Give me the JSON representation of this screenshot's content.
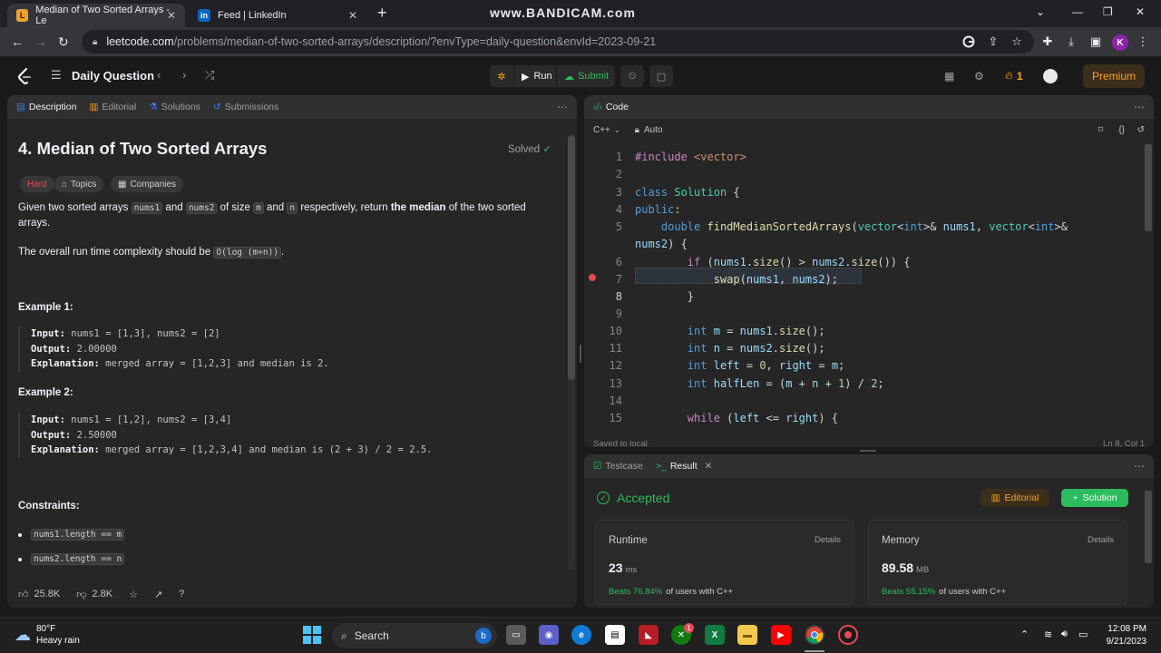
{
  "browser": {
    "tabs": [
      {
        "title": "Median of Two Sorted Arrays - Le"
      },
      {
        "title": "Feed | LinkedIn"
      }
    ],
    "watermark": "www.BANDICAM.com",
    "url_host": "leetcode.com",
    "url_path": "/problems/median-of-two-sorted-arrays/description/?envType=daily-question&envId=2023-09-21",
    "profile_initial": "K"
  },
  "nav": {
    "daily_label": "Daily Question",
    "run_label": "Run",
    "submit_label": "Submit",
    "streak": "1",
    "premium_label": "Premium"
  },
  "desc_tabs": [
    "Description",
    "Editorial",
    "Solutions",
    "Submissions"
  ],
  "problem": {
    "title": "4. Median of Two Sorted Arrays",
    "solved": "Solved",
    "difficulty": "Hard",
    "tag_topics": "Topics",
    "tag_companies": "Companies",
    "p1a": "Given two sorted arrays ",
    "c_nums1": "nums1",
    "p1b": " and ",
    "c_nums2": "nums2",
    "p1c": " of size ",
    "c_m": "m",
    "p1d": " and ",
    "c_n": "n",
    "p1e": " respectively, return ",
    "p1bold": "the median",
    "p1f": " of the two sorted",
    "p1g": "arrays.",
    "p2a": "The overall run time complexity should be ",
    "c_complexity": "O(log (m+n))",
    "p2b": ".",
    "ex1_title": "Example 1:",
    "ex1_input_label": "Input:",
    "ex1_input": " nums1 = [1,3], nums2 = [2]",
    "ex1_output_label": "Output:",
    "ex1_output": " 2.00000",
    "ex1_expl_label": "Explanation:",
    "ex1_expl": " merged array = [1,2,3] and median is 2.",
    "ex2_title": "Example 2:",
    "ex2_input_label": "Input:",
    "ex2_input": " nums1 = [1,2], nums2 = [3,4]",
    "ex2_output_label": "Output:",
    "ex2_output": " 2.50000",
    "ex2_expl_label": "Explanation:",
    "ex2_expl": " merged array = [1,2,3,4] and median is (2 + 3) / 2 = 2.5.",
    "constraints_title": "Constraints:",
    "constraint1": "nums1.length == m",
    "constraint2": "nums2.length == n",
    "likes": "25.8K",
    "dislikes": "2.8K"
  },
  "code": {
    "tab_label": "Code",
    "language": "C++",
    "auto_label": "Auto",
    "status_left": "Saved to local",
    "status_right": "Ln 8, Col 1",
    "line_numbers": [
      "1",
      "2",
      "3",
      "4",
      "5",
      "",
      "6",
      "7",
      "8",
      "9",
      "10",
      "11",
      "12",
      "13",
      "14",
      "15"
    ]
  },
  "result": {
    "tab_testcase": "Testcase",
    "tab_result": "Result",
    "status": "Accepted",
    "editorial_btn": "Editorial",
    "solution_btn": "Solution",
    "runtime_label": "Runtime",
    "runtime_value": "23",
    "runtime_unit": "ms",
    "runtime_beats": "Beats 76.84%",
    "runtime_suffix": "of users with C++",
    "memory_label": "Memory",
    "memory_value": "89.58",
    "memory_unit": "MB",
    "memory_beats": "Beats 55.15%",
    "memory_suffix": "of users with C++",
    "details_label": "Details"
  },
  "taskbar": {
    "temp": "80°F",
    "weather": "Heavy rain",
    "search": "Search",
    "time": "12:08 PM",
    "date": "9/21/2023",
    "badge": "1"
  }
}
